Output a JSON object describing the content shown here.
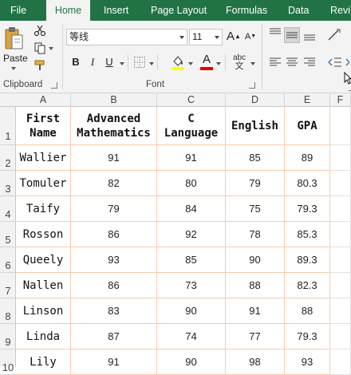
{
  "tabs": [
    {
      "label": "File",
      "active": false
    },
    {
      "label": "Home",
      "active": true
    },
    {
      "label": "Insert",
      "active": false
    },
    {
      "label": "Page Layout",
      "active": false
    },
    {
      "label": "Formulas",
      "active": false
    },
    {
      "label": "Data",
      "active": false
    },
    {
      "label": "Revi",
      "active": false
    }
  ],
  "ribbon": {
    "clipboard": {
      "label": "Clipboard",
      "paste_label": "Paste",
      "icons": [
        "paste-icon",
        "cut-icon",
        "copy-icon",
        "format-painter-icon"
      ]
    },
    "font": {
      "label": "Font",
      "font_name": "等线",
      "font_size": "11",
      "bold": "B",
      "italic": "I",
      "underline": "U",
      "grow": "A",
      "shrink": "A",
      "font_color_letter": "A",
      "phonetic": "abc",
      "phonetic_sub": "文",
      "fill_color": "#ffff00",
      "font_color": "#e00000"
    },
    "alignment": {
      "icons": [
        "align-top-icon",
        "align-middle-icon",
        "align-bottom-icon",
        "orientation-icon",
        "align-left-icon",
        "align-center-icon",
        "align-right-icon",
        "decrease-indent-icon"
      ]
    }
  },
  "columns": [
    "A",
    "B",
    "C",
    "D",
    "E",
    "F"
  ],
  "rows": [
    "1",
    "2",
    "3",
    "4",
    "5",
    "6",
    "7",
    "8",
    "9",
    "10"
  ],
  "table": {
    "headers": [
      "First\nName",
      "Advanced\nMathematics",
      "C\nLanguage",
      "English",
      "GPA"
    ],
    "data": [
      [
        "Wallier",
        "91",
        "91",
        "85",
        "89"
      ],
      [
        "Tomuler",
        "82",
        "80",
        "79",
        "80.3"
      ],
      [
        "Taify",
        "79",
        "84",
        "75",
        "79.3"
      ],
      [
        "Rosson",
        "86",
        "92",
        "78",
        "85.3"
      ],
      [
        "Queely",
        "93",
        "85",
        "90",
        "89.3"
      ],
      [
        "Nallen",
        "86",
        "73",
        "88",
        "82.3"
      ],
      [
        "Linson",
        "83",
        "90",
        "91",
        "88"
      ],
      [
        "Linda",
        "87",
        "74",
        "77",
        "79.3"
      ],
      [
        "Lily",
        "91",
        "90",
        "98",
        "93"
      ]
    ]
  },
  "colors": {
    "ribbon_green": "#217346",
    "table_border": "#f8cbad"
  }
}
